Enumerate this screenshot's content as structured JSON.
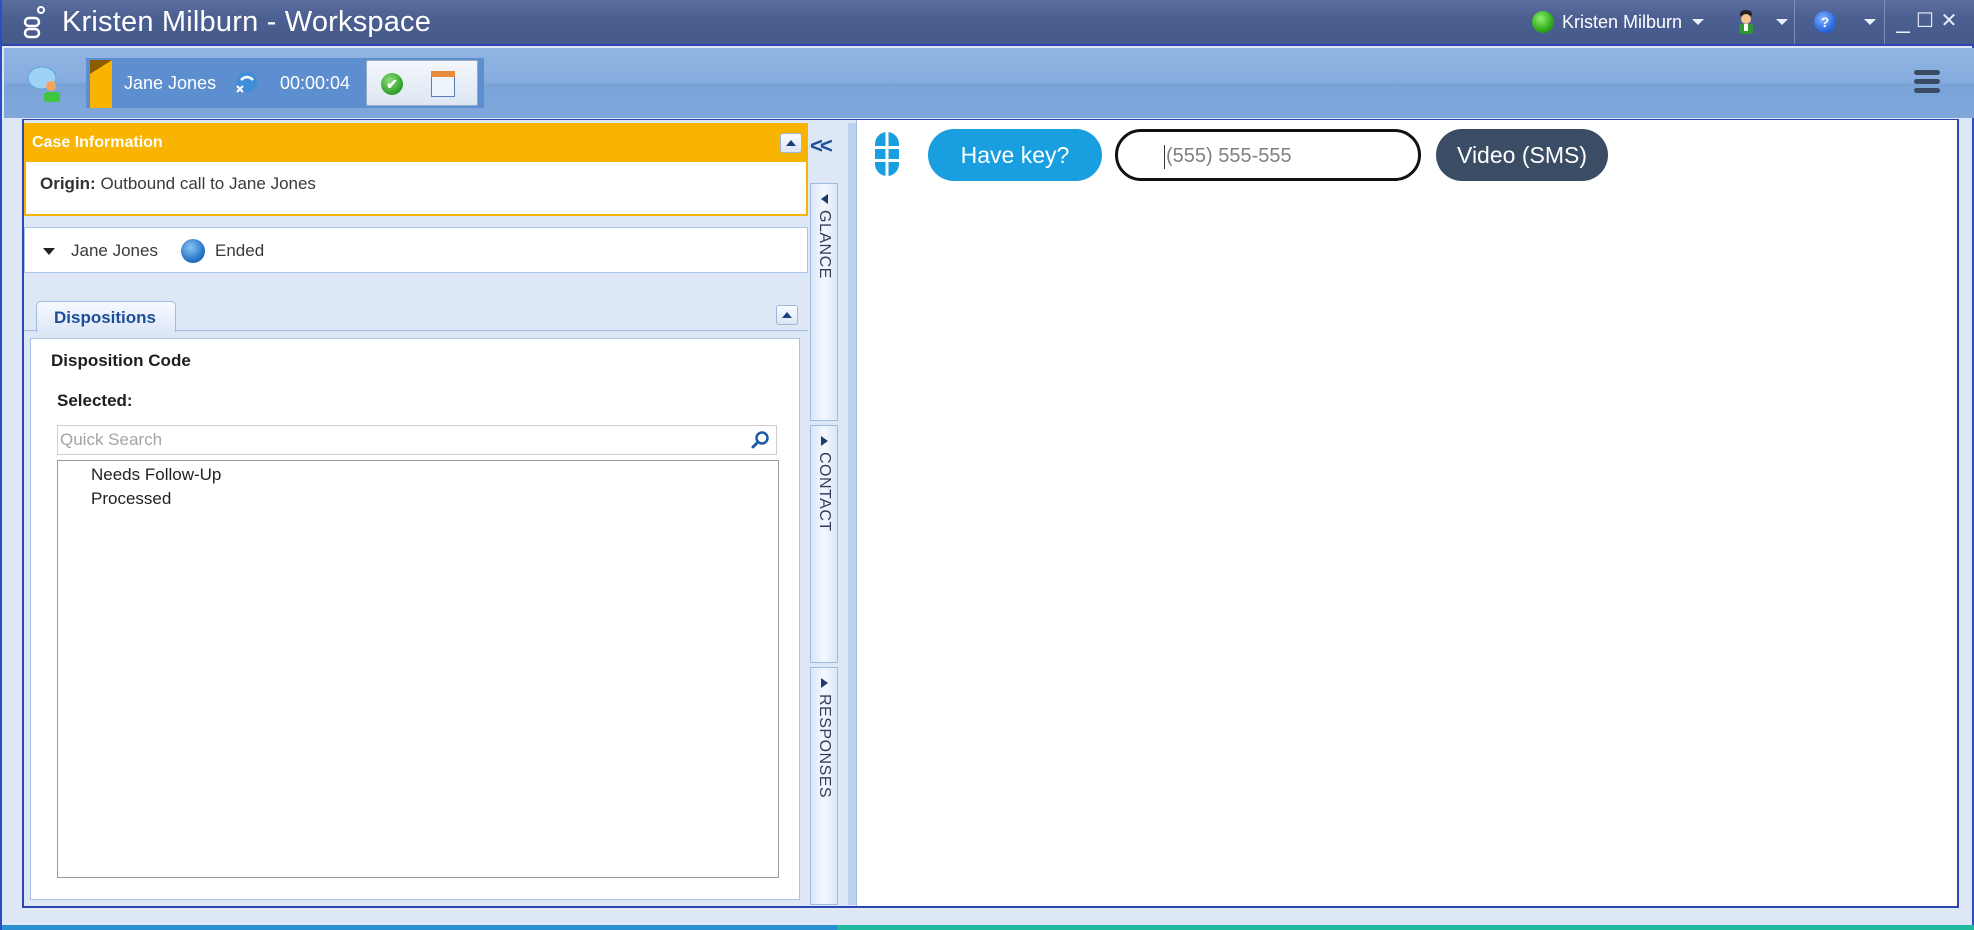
{
  "window": {
    "title": "Kristen Milburn - Workspace",
    "user_name": "Kristen Milburn",
    "status_color": "#2fa91d",
    "controls": {
      "minimize": "_",
      "maximize": "☐",
      "close": "✕"
    },
    "help_glyph": "?"
  },
  "toolbar": {
    "interaction": {
      "contact_name": "Jane Jones",
      "timer": "00:00:04",
      "color_tag": "#f8b400",
      "done_glyph": "✔"
    }
  },
  "case": {
    "header": "Case Information",
    "origin_label": "Origin:",
    "origin_value": "Outbound call to Jane Jones",
    "party_name": "Jane Jones",
    "party_status": "Ended"
  },
  "dispositions": {
    "tab_label": "Dispositions",
    "title": "Disposition Code",
    "selected_label": "Selected:",
    "search_placeholder": "Quick Search",
    "items": [
      "Needs Follow-Up",
      "Processed"
    ]
  },
  "side_tabs": {
    "collapse_glyph": "<<",
    "items": [
      "GLANCE",
      "CONTACT",
      "RESPONSES"
    ]
  },
  "content": {
    "have_key_label": "Have key?",
    "phone_placeholder": "(555) 555-555",
    "video_sms_label": "Video (SMS)",
    "accent_color": "#199fdf",
    "dark_button_color": "#3b4c65"
  }
}
